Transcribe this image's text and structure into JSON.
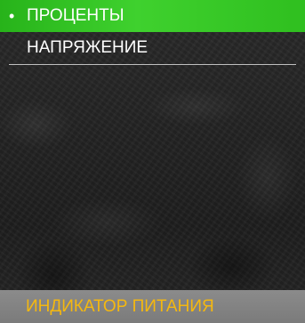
{
  "menu": {
    "items": [
      {
        "label": "ПРОЦЕНТЫ",
        "selected": true,
        "bullet": "•"
      },
      {
        "label": "НАПРЯЖЕНИЕ",
        "selected": false,
        "bullet": ""
      }
    ]
  },
  "footer": {
    "title": "ИНДИКАТОР ПИТАНИЯ"
  },
  "colors": {
    "selection": "#2fbf1f",
    "footer_text": "#f5b80f",
    "footer_bg": "#838383",
    "menu_text": "#ffffff"
  }
}
